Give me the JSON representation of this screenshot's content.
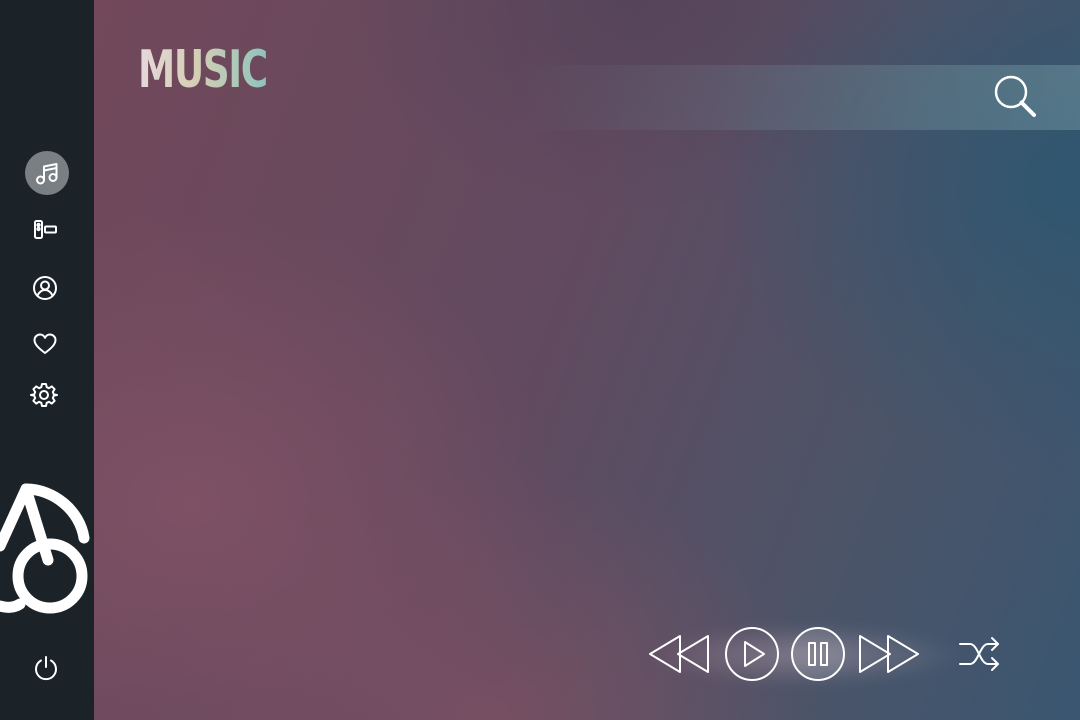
{
  "header": {
    "title": "MUSIC"
  },
  "search": {
    "value": "",
    "placeholder": "",
    "icon": "search-icon"
  },
  "sidebar": {
    "items": [
      {
        "id": "music",
        "icon": "music-note-icon",
        "active": true
      },
      {
        "id": "radio",
        "icon": "radio-icon",
        "active": false
      },
      {
        "id": "profile",
        "icon": "user-circle-icon",
        "active": false
      },
      {
        "id": "favorites",
        "icon": "heart-icon",
        "active": false
      },
      {
        "id": "settings",
        "icon": "gear-icon",
        "active": false
      }
    ],
    "logo_icon": "cherry-logo-icon",
    "power_icon": "power-icon"
  },
  "player": {
    "controls": [
      {
        "id": "rewind",
        "icon": "rewind-icon"
      },
      {
        "id": "play",
        "icon": "play-icon"
      },
      {
        "id": "pause",
        "icon": "pause-icon"
      },
      {
        "id": "forward",
        "icon": "fast-forward-icon"
      },
      {
        "id": "shuffle",
        "icon": "shuffle-icon"
      }
    ]
  },
  "colors": {
    "sidebar_bg": "#1b2228",
    "active_item_bg": "#7a7f84",
    "accent_pink": "#72485a",
    "accent_teal": "#3a5670",
    "icon_stroke": "#e9e6ea"
  }
}
